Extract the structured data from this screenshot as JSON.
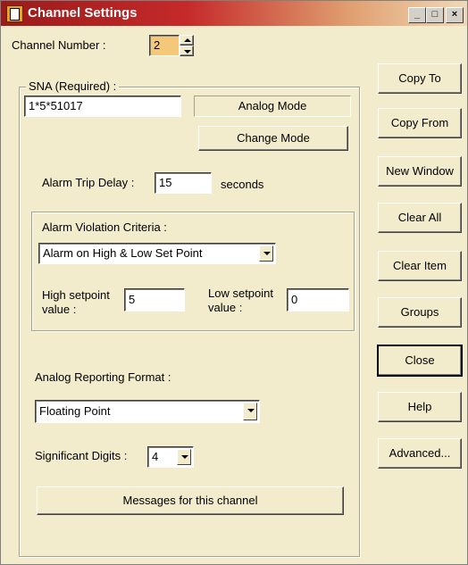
{
  "window": {
    "title": "Channel Settings",
    "minimize": "_",
    "maximize": "□",
    "close": "×"
  },
  "channel": {
    "label": "Channel Number :",
    "value": "2"
  },
  "sna": {
    "group_label": "SNA (Required) :",
    "value": "1*5*51017",
    "mode_text": "Analog Mode",
    "change_mode_label": "Change Mode"
  },
  "alarm_trip": {
    "label": "Alarm Trip Delay :",
    "value": "15",
    "unit": "seconds"
  },
  "violation": {
    "group_label": "Alarm Violation Criteria :",
    "selected": "Alarm on High & Low Set Point",
    "high_label_1": "High setpoint",
    "high_label_2": "value :",
    "high_value": "5",
    "low_label_1": "Low setpoint",
    "low_label_2": "value :",
    "low_value": "0"
  },
  "reporting": {
    "label": "Analog Reporting Format :",
    "selected": "Floating Point"
  },
  "digits": {
    "label": "Significant Digits :",
    "selected": "4"
  },
  "messages_button": "Messages for this channel",
  "side_buttons": {
    "copy_to": "Copy To",
    "copy_from": "Copy From",
    "new_window": "New Window",
    "clear_all": "Clear All",
    "clear_item": "Clear Item",
    "groups": "Groups",
    "close": "Close",
    "help": "Help",
    "advanced": "Advanced..."
  }
}
